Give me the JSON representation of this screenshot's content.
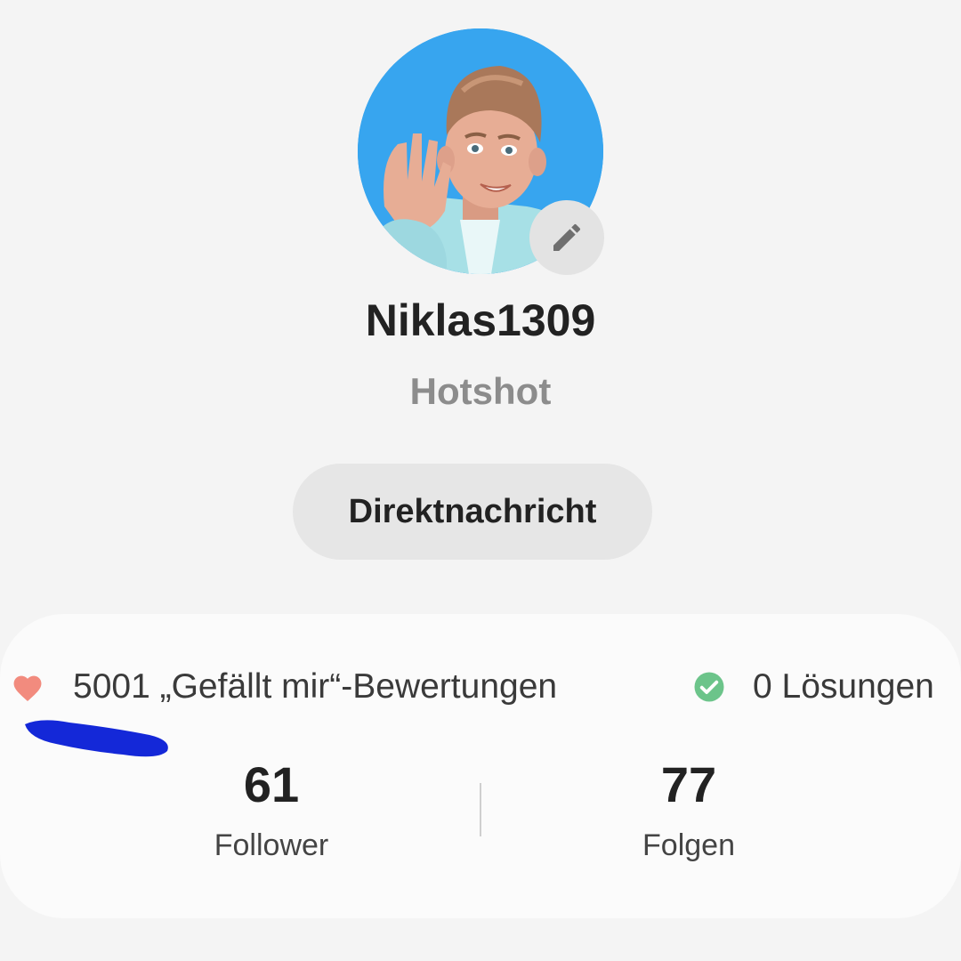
{
  "profile": {
    "username": "Niklas1309",
    "rank": "Hotshot",
    "avatar_icon": "memoji-avatar",
    "avatar_bg_color": "#37a5ef",
    "edit_icon": "pencil-icon"
  },
  "actions": {
    "direct_message_label": "Direktnachricht"
  },
  "stats": {
    "likes_icon": "heart-icon",
    "likes_color": "#f28b7e",
    "likes_text": "5001 „Gefällt mir“-Bewertungen",
    "solutions_icon": "check-circle-icon",
    "solutions_color": "#6cc48a",
    "solutions_text": "0 Lösungen"
  },
  "follow": {
    "followers_count": "61",
    "followers_label": "Follower",
    "following_count": "77",
    "following_label": "Folgen"
  },
  "annotation": {
    "scribble_color": "#1428d8"
  }
}
